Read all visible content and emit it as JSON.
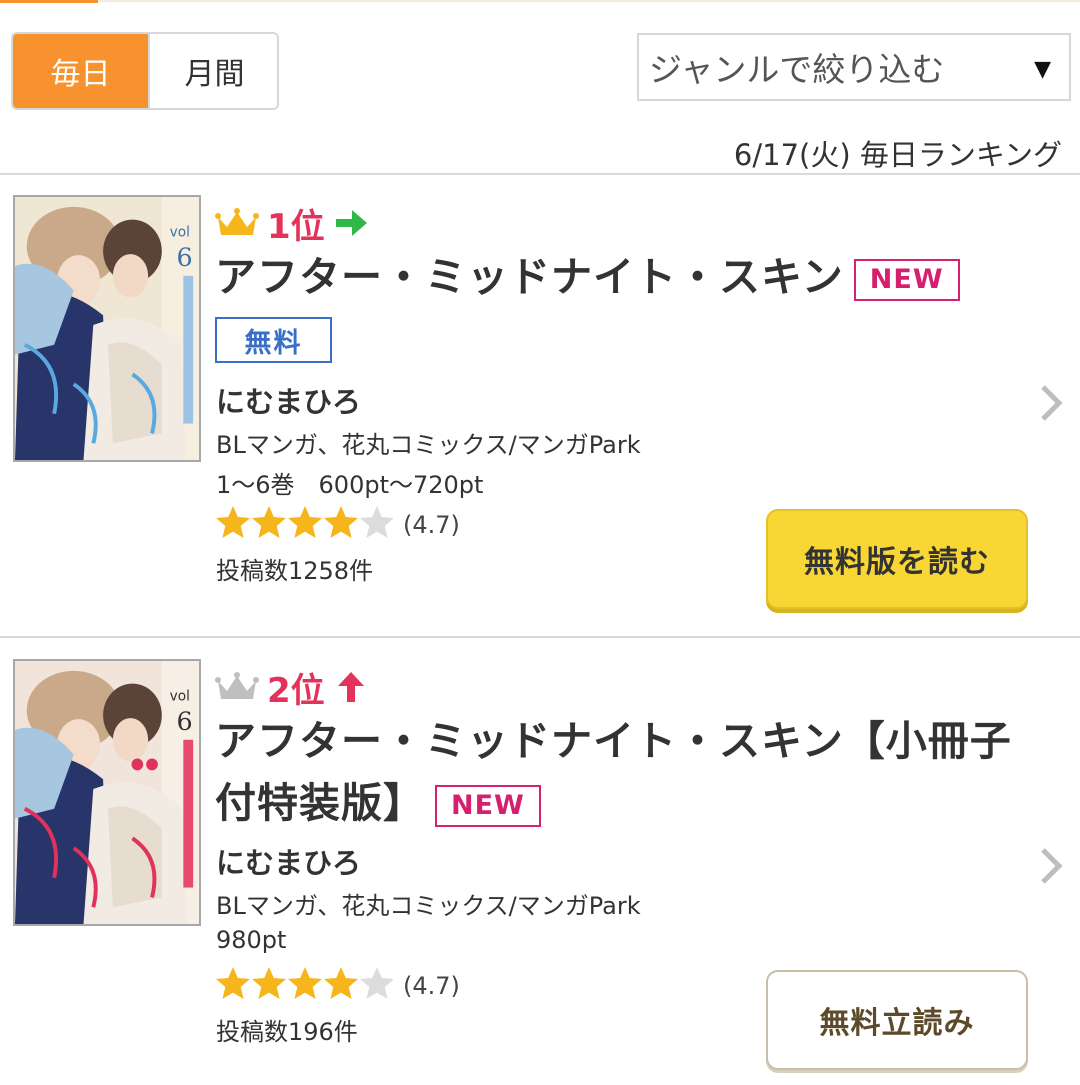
{
  "tabs": {
    "daily": "毎日",
    "monthly": "月間"
  },
  "genre_filter": {
    "placeholder": "ジャンルで絞り込む",
    "arrow": "▼"
  },
  "ranking_date": "6/17(火) 毎日ランキング",
  "colors": {
    "accent": "#f7922f",
    "rank": "#e3335a",
    "new": "#d6206f",
    "free": "#3a6fc8",
    "star": "#f5b51b"
  },
  "items": [
    {
      "rank": "1位",
      "trend": "same",
      "title": "アフターﾟ・ミッドナイト・スキン",
      "new_label": "NEW",
      "free_label": "無料",
      "author": "にむまひろ",
      "genre": "BLマンガ、花丸コミックス/マンガPark",
      "price": "1〜6巻　600pt〜720pt",
      "rating_value": 4.7,
      "rating": "(4.7)",
      "posts": "投稿数1258件",
      "button": "無料版を読む"
    },
    {
      "rank": "2位",
      "trend": "up",
      "title": "アフター・ミッドナイト・スキン【小冊子付特装版】",
      "new_label": "NEW",
      "author": "にむまひろ",
      "genre": "BLマンガ、花丸コミックス/マンガPark",
      "price": "980pt",
      "rating_value": 4.7,
      "rating": "(4.7)",
      "posts": "投稿数196件",
      "button": "無料立読み"
    }
  ]
}
